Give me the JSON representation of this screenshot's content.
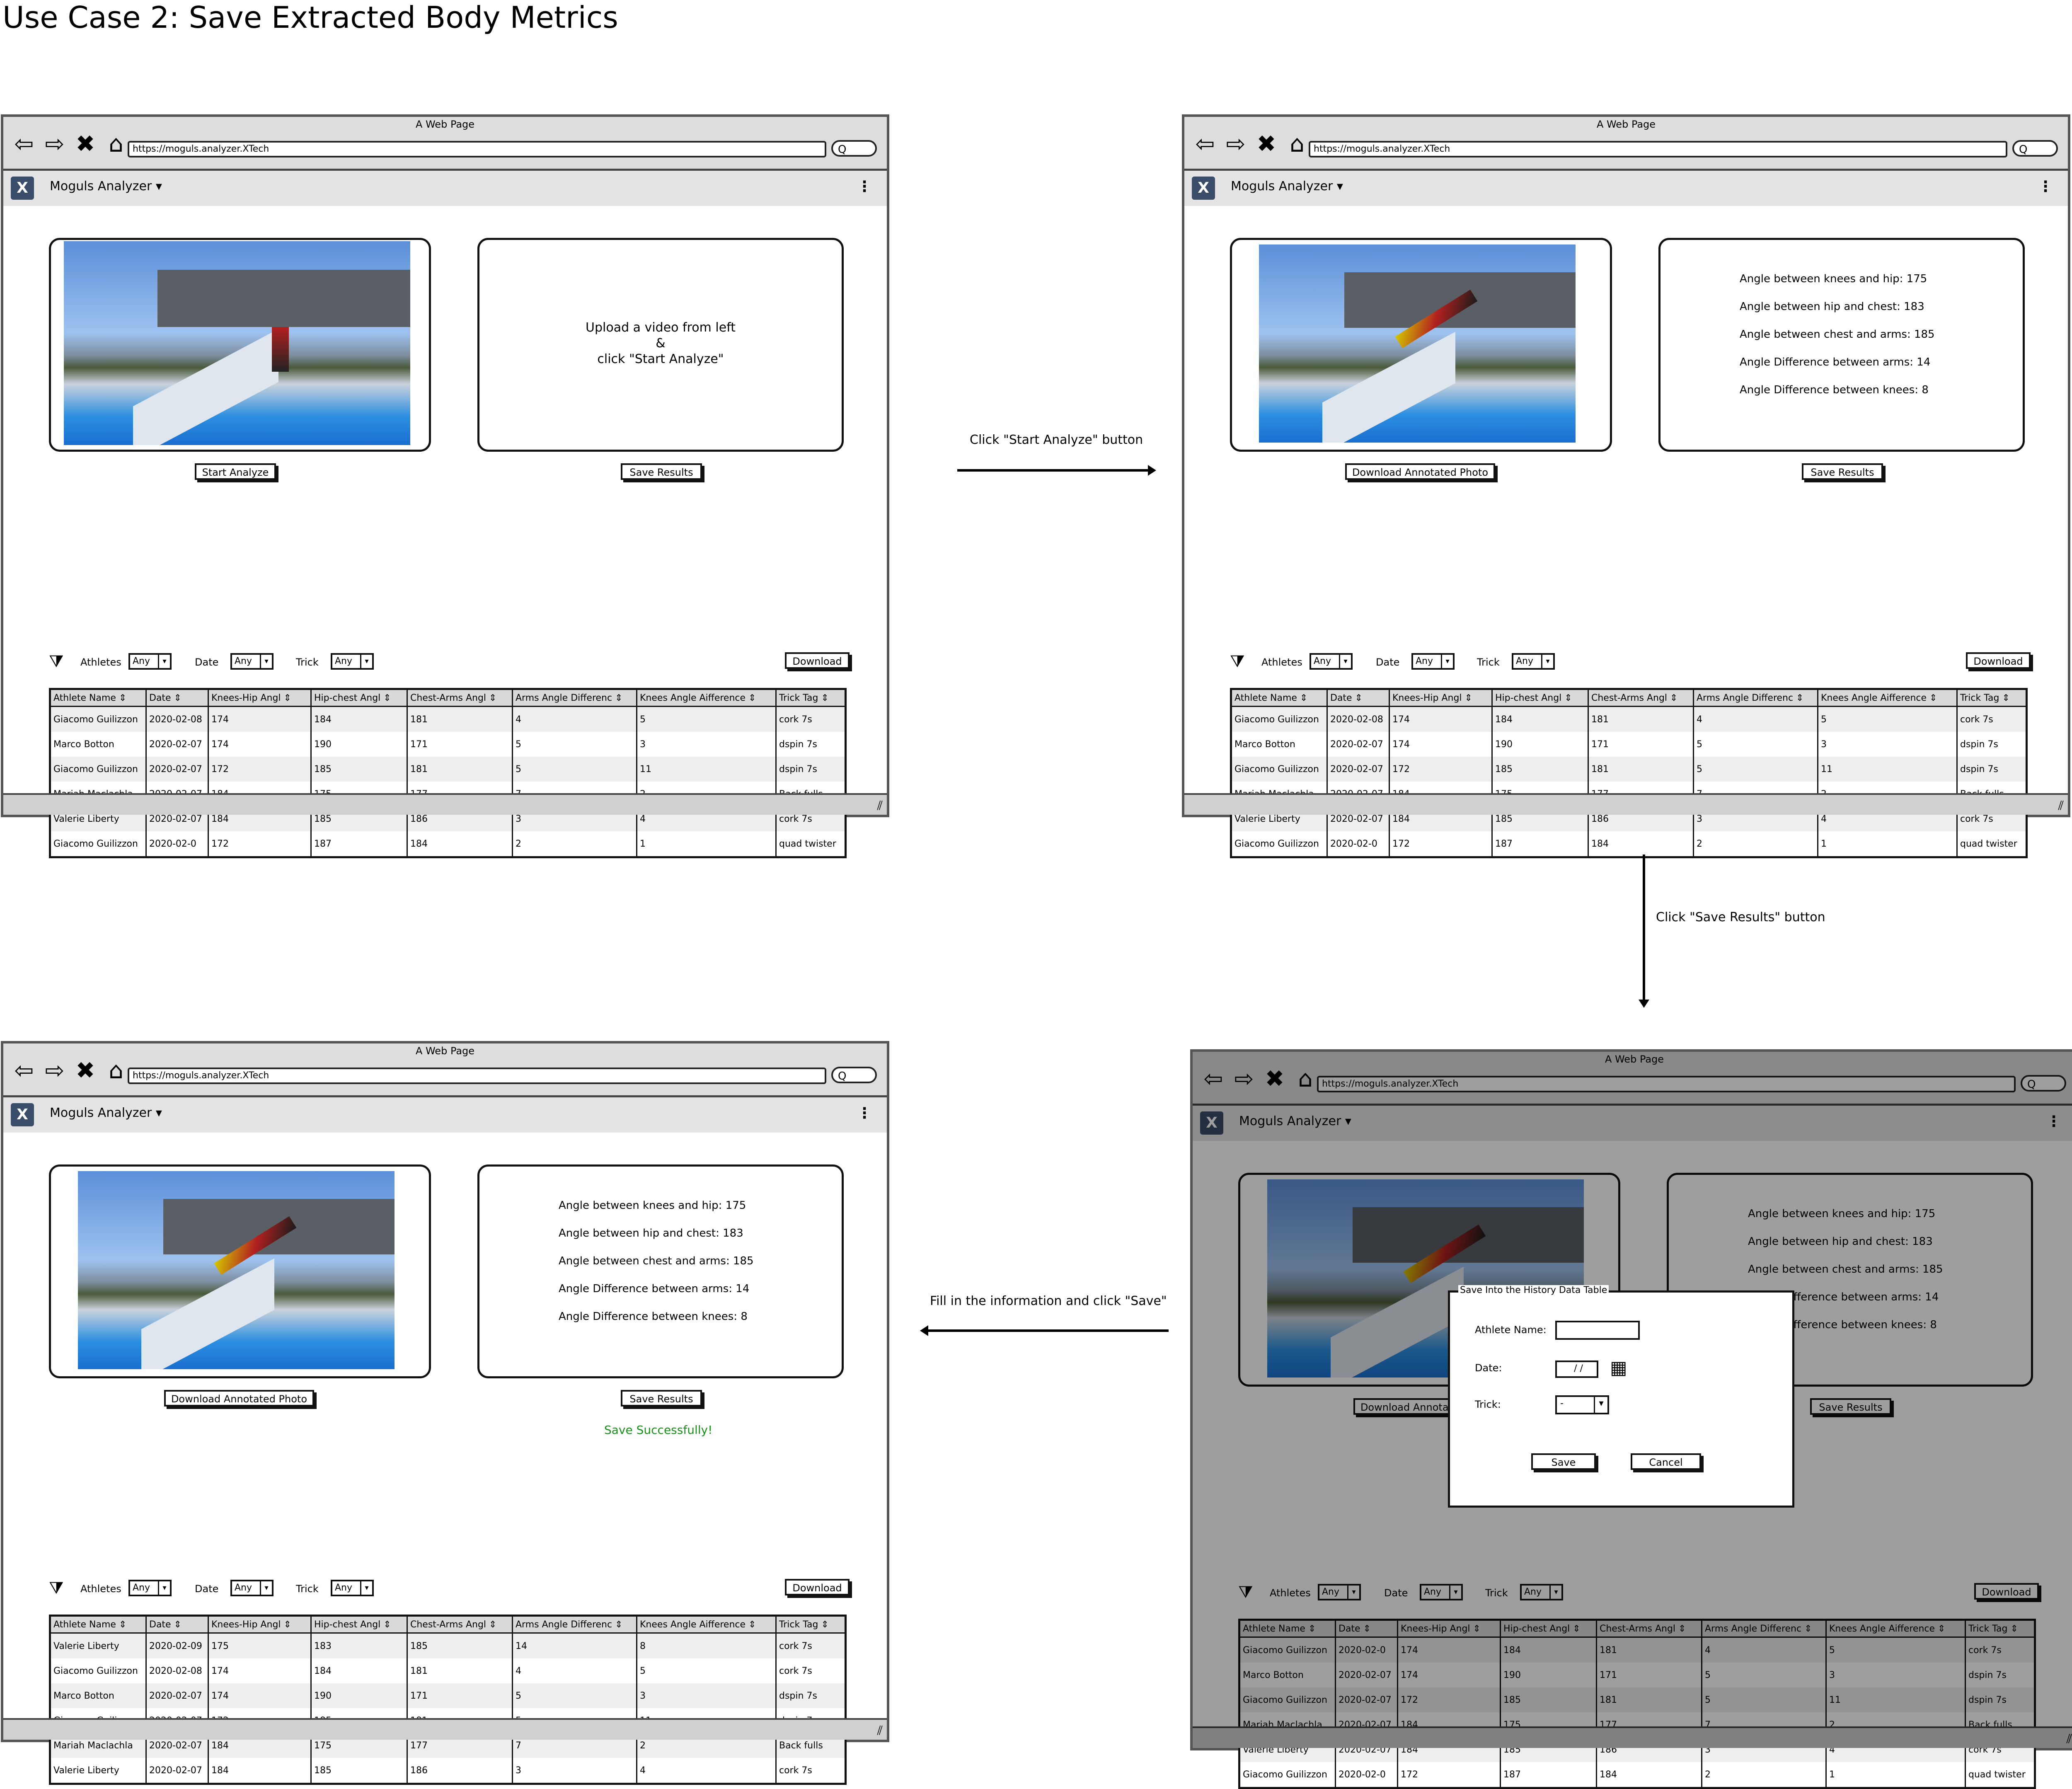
{
  "title": "Use Case 2: Save Extracted Body Metrics",
  "browser": {
    "page_label": "A Web Page",
    "url": "https://moguls.analyzer.XTech",
    "app_name": "Moguls Analyzer",
    "logo_text": "X",
    "kebab": "⋮",
    "search_glyph": "Q"
  },
  "labels": {
    "start_analyze": "Start Analyze",
    "save_results": "Save Results",
    "download_annotated_photo": "Download Annotated Photo",
    "download": "Download",
    "athletes": "Athletes",
    "date": "Date",
    "trick": "Trick",
    "any": "Any",
    "save_success": "Save Successfully!"
  },
  "upload_message": [
    "Upload a video from left",
    "&",
    "click \"Start Analyze\""
  ],
  "metrics": [
    "Angle between knees and hip: 175",
    "Angle between hip and chest: 183",
    "Angle between chest and arms: 185",
    "Angle Difference between arms: 14",
    "Angle Difference between knees: 8"
  ],
  "arrows": {
    "step1": "Click \"Start Analyze\" button",
    "step2": "Click \"Save Results\" button",
    "step3": "Fill in the information and click \"Save\""
  },
  "table": {
    "headers": [
      "Athlete Name",
      "Date",
      "Knees-Hip Angl",
      "Hip-chest Angl",
      "Chest-Arms Angl",
      "Arms Angle Differenc",
      "Knees Angle Aifference",
      "Trick Tag"
    ],
    "rows": [
      [
        "Giacomo Guilizzon",
        "2020-02-08",
        "174",
        "184",
        "181",
        "4",
        "5",
        "cork 7s"
      ],
      [
        "Marco Botton",
        "2020-02-07",
        "174",
        "190",
        "171",
        "5",
        "3",
        "dspin 7s"
      ],
      [
        "Giacomo Guilizzon",
        "2020-02-07",
        "172",
        "185",
        "181",
        "5",
        "11",
        "dspin 7s"
      ],
      [
        "Mariah Maclachla",
        "2020-02-07",
        "184",
        "175",
        "177",
        "7",
        "2",
        "Back fulls"
      ],
      [
        "Valerie Liberty",
        "2020-02-07",
        "184",
        "185",
        "186",
        "3",
        "4",
        "cork 7s"
      ],
      [
        "Giacomo Guilizzon",
        "2020-02-0",
        "172",
        "187",
        "184",
        "2",
        "1",
        "quad twister"
      ]
    ],
    "rows_dialog": [
      [
        "Giacomo Guilizzon",
        "2020-02-0",
        "174",
        "184",
        "181",
        "4",
        "5",
        "cork 7s"
      ],
      [
        "Marco Botton",
        "2020-02-07",
        "174",
        "190",
        "171",
        "5",
        "3",
        "dspin 7s"
      ],
      [
        "Giacomo Guilizzon",
        "2020-02-07",
        "172",
        "185",
        "181",
        "5",
        "11",
        "dspin 7s"
      ],
      [
        "Mariah Maclachla",
        "2020-02-07",
        "184",
        "175",
        "177",
        "7",
        "2",
        "Back fulls"
      ],
      [
        "Valerie Liberty",
        "2020-02-07",
        "184",
        "185",
        "186",
        "3",
        "4",
        "cork 7s"
      ],
      [
        "Giacomo Guilizzon",
        "2020-02-0",
        "172",
        "187",
        "184",
        "2",
        "1",
        "quad twister"
      ]
    ],
    "rows_saved": [
      [
        "Valerie Liberty",
        "2020-02-09",
        "175",
        "183",
        "185",
        "14",
        "8",
        "cork 7s"
      ],
      [
        "Giacomo Guilizzon",
        "2020-02-08",
        "174",
        "184",
        "181",
        "4",
        "5",
        "cork 7s"
      ],
      [
        "Marco Botton",
        "2020-02-07",
        "174",
        "190",
        "171",
        "5",
        "3",
        "dspin 7s"
      ],
      [
        "Giacomo Guilizzon",
        "2020-02-07",
        "172",
        "185",
        "181",
        "5",
        "11",
        "dspin 7s"
      ],
      [
        "Mariah Maclachla",
        "2020-02-07",
        "184",
        "175",
        "177",
        "7",
        "2",
        "Back fulls"
      ],
      [
        "Valerie Liberty",
        "2020-02-07",
        "184",
        "185",
        "186",
        "3",
        "4",
        "cork 7s"
      ]
    ]
  },
  "dialog": {
    "title": "Save Into the History Data Table",
    "athlete_label": "Athlete Name:",
    "date_label": "Date:",
    "date_value": "/ /",
    "trick_label": "Trick:",
    "trick_value": "-",
    "save": "Save",
    "cancel": "Cancel"
  }
}
